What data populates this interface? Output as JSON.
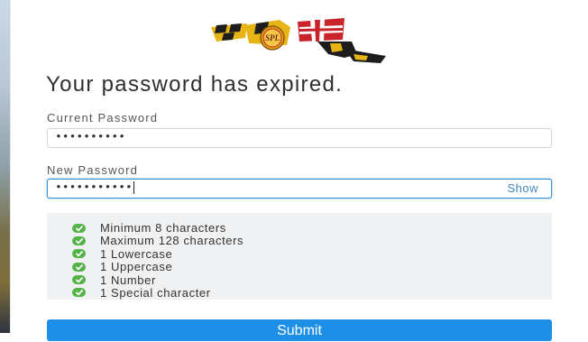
{
  "page": {
    "title": "Your password has expired."
  },
  "logo": {
    "name": "maryland-flag-logo",
    "text": "SPL"
  },
  "form": {
    "current_password": {
      "label": "Current Password",
      "value": "••••••••••"
    },
    "new_password": {
      "label": "New Password",
      "value": "•••••••••••",
      "show_label": "Show"
    }
  },
  "requirements": [
    {
      "label": "Minimum 8 characters",
      "met": true
    },
    {
      "label": "Maximum 128 characters",
      "met": true
    },
    {
      "label": "1 Lowercase",
      "met": true
    },
    {
      "label": "1 Uppercase",
      "met": true
    },
    {
      "label": "1 Number",
      "met": true
    },
    {
      "label": "1 Special character",
      "met": true
    }
  ],
  "submit": {
    "label": "Submit"
  },
  "colors": {
    "accent": "#1e8fe6",
    "success": "#55b349",
    "focus": "#3a8fd0"
  }
}
